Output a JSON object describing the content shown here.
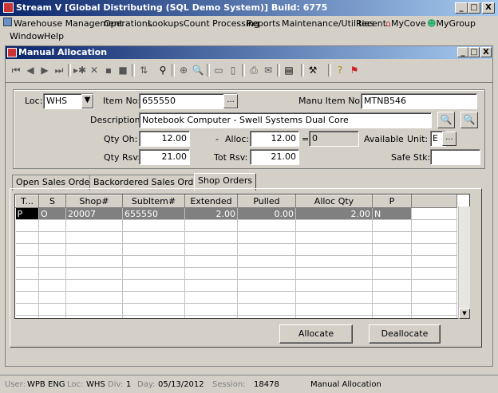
{
  "window": {
    "title": "Stream V [Global Distributing (SQL Demo System)] Build: 6775",
    "controls": [
      "_",
      "□",
      "X"
    ]
  },
  "menu": {
    "row1": [
      "Warehouse Management",
      "Operations",
      "Lookups",
      "Count Processing",
      "Reports",
      "Maintenance/Utilities",
      "Recent",
      "MyCove",
      "MyGroup"
    ],
    "row2": [
      "Window",
      "Help"
    ]
  },
  "mdi": {
    "title": "Manual Allocation",
    "controls": [
      "_",
      "□",
      "X"
    ]
  },
  "form": {
    "loc_label": "Loc:",
    "loc_value": "WHS",
    "item_no_label": "Item No:",
    "item_no_value": "655550",
    "manu_item_label": "Manu Item No:",
    "manu_item_value": "MTNB546",
    "description_label": "Description:",
    "description_value": "Notebook Computer - Swell Systems Dual Core",
    "qty_oh_label": "Qty Oh:",
    "qty_oh_value": "12.00",
    "alloc_label": "Alloc:",
    "minus": "-",
    "alloc_value": "12.00",
    "equals": "=",
    "available_value": "0",
    "available_label": "Available",
    "unit_label": "Unit:",
    "unit_value": "E",
    "qty_rsv_label": "Qty Rsv:",
    "qty_rsv_value": "21.00",
    "tot_rsv_label": "Tot Rsv:",
    "tot_rsv_value": "21.00",
    "safe_stk_label": "Safe Stk:",
    "safe_stk_value": "",
    "ellipsis": "..."
  },
  "tabs": [
    "Open Sales Orders",
    "Backordered Sales Orders",
    "Shop Orders"
  ],
  "active_tab": "Shop Orders",
  "grid": {
    "columns": [
      "T...",
      "S",
      "Shop#",
      "SubItem#",
      "Extended",
      "Pulled",
      "Alloc Qty",
      "P"
    ],
    "rows": [
      [
        "P",
        "O",
        "20007",
        "655550",
        "2.00",
        "0.00",
        "2.00",
        "N"
      ]
    ]
  },
  "buttons": {
    "allocate": "Allocate",
    "deallocate": "Deallocate"
  },
  "status": {
    "user_label": "User:",
    "user": "WPB",
    "lang": "ENG",
    "loc_label": "Loc:",
    "loc": "WHS",
    "div_label": "Div:",
    "div": "1",
    "day_label": "Day:",
    "day": "05/13/2012",
    "session_label": "Session:",
    "session": "18478",
    "screen": "Manual Allocation"
  }
}
